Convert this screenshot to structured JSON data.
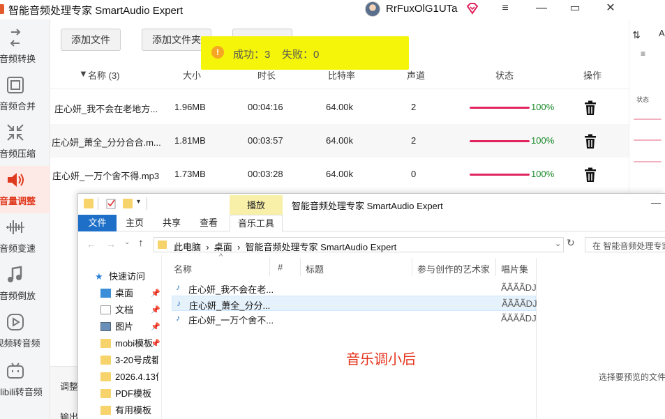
{
  "app": {
    "title": "智能音频处理专家 SmartAudio Expert",
    "username": "RrFuxOlG1UTa",
    "vip_icon": "vip-diamond-icon"
  },
  "window_controls": {
    "menu": "≡",
    "minimize": "—",
    "maximize": "▭",
    "close": "✕"
  },
  "sidebar": {
    "items": [
      {
        "label": "音频转换",
        "icon": "audio-convert-icon"
      },
      {
        "label": "音频合并",
        "icon": "audio-merge-icon"
      },
      {
        "label": "音频压缩",
        "icon": "audio-compress-icon"
      },
      {
        "label": "音量调整",
        "icon": "volume-icon",
        "active": true
      },
      {
        "label": "音频变速",
        "icon": "speed-wave-icon"
      },
      {
        "label": "音频倒放",
        "icon": "music-note-icon"
      },
      {
        "label": "视频转音频",
        "icon": "video-play-icon"
      },
      {
        "label": "bilibili转音频",
        "icon": "bilibili-icon"
      }
    ]
  },
  "toolbar": {
    "add_file": "添加文件",
    "add_folder": "添加文件夹"
  },
  "toast": {
    "text": "成功：3    失败：0",
    "icon": "info-icon",
    "color": "#f5f50a"
  },
  "table": {
    "columns": [
      "名称 (3)",
      "大小",
      "时长",
      "比特率",
      "声道",
      "状态",
      "操作"
    ],
    "rows": [
      {
        "name": "庄心妍_我不会在老地方...",
        "size": "1.96MB",
        "duration": "00:04:16",
        "bitrate": "64.00k",
        "channels": "2",
        "progress": 1.0,
        "status": "100%"
      },
      {
        "name": "庄心妍_萧全_分分合合.m...",
        "size": "1.81MB",
        "duration": "00:03:57",
        "bitrate": "64.00k",
        "channels": "2",
        "progress": 1.0,
        "status": "100%"
      },
      {
        "name": "庄心妍_一万个舍不得.mp3",
        "size": "1.73MB",
        "duration": "00:03:28",
        "bitrate": "64.00k",
        "channels": "0",
        "progress": 1.0,
        "status": "100%"
      }
    ]
  },
  "right_partial": {
    "status_label": "状态"
  },
  "bottom_panel": {
    "adjust_label": "调整",
    "output_label": "输出"
  },
  "explorer": {
    "title": "智能音频处理专家 SmartAudio Expert",
    "play_tab": "播放",
    "ribbon_tabs": [
      "文件",
      "主页",
      "共享",
      "查看",
      "音乐工具"
    ],
    "address": "此电脑  ›  桌面  ›  智能音频处理专家 SmartAudio Expert",
    "search_placeholder": "在 智能音频处理专家",
    "nav": [
      {
        "label": "快速访问",
        "icon": "star-icon"
      },
      {
        "label": "桌面",
        "icon": "desktop-icon",
        "pinned": true
      },
      {
        "label": "文档",
        "icon": "document-icon",
        "pinned": true
      },
      {
        "label": "图片",
        "icon": "picture-icon",
        "pinned": true
      },
      {
        "label": "mobi模板",
        "icon": "folder-icon",
        "pinned": true
      },
      {
        "label": "3-20号成都",
        "icon": "folder-icon"
      },
      {
        "label": "2026.4.13保",
        "icon": "folder-icon"
      },
      {
        "label": "PDF模板",
        "icon": "folder-icon"
      },
      {
        "label": "有用模板",
        "icon": "folder-icon"
      }
    ],
    "columns": [
      "名称",
      "#",
      "标题",
      "参与创作的艺术家",
      "唱片集"
    ],
    "files": [
      {
        "name": "庄心妍_我不会在老...",
        "album": "ÃÃÃÃDJ("
      },
      {
        "name": "庄心妍_萧全_分分...",
        "album": "ÃÃÃÃDJ(",
        "selected": true
      },
      {
        "name": "庄心妍_一万个舍不...",
        "album": "ÃÃÃÃDJ("
      }
    ],
    "annotation": "音乐调小后",
    "preview_hint": "选择要预览的文件"
  }
}
